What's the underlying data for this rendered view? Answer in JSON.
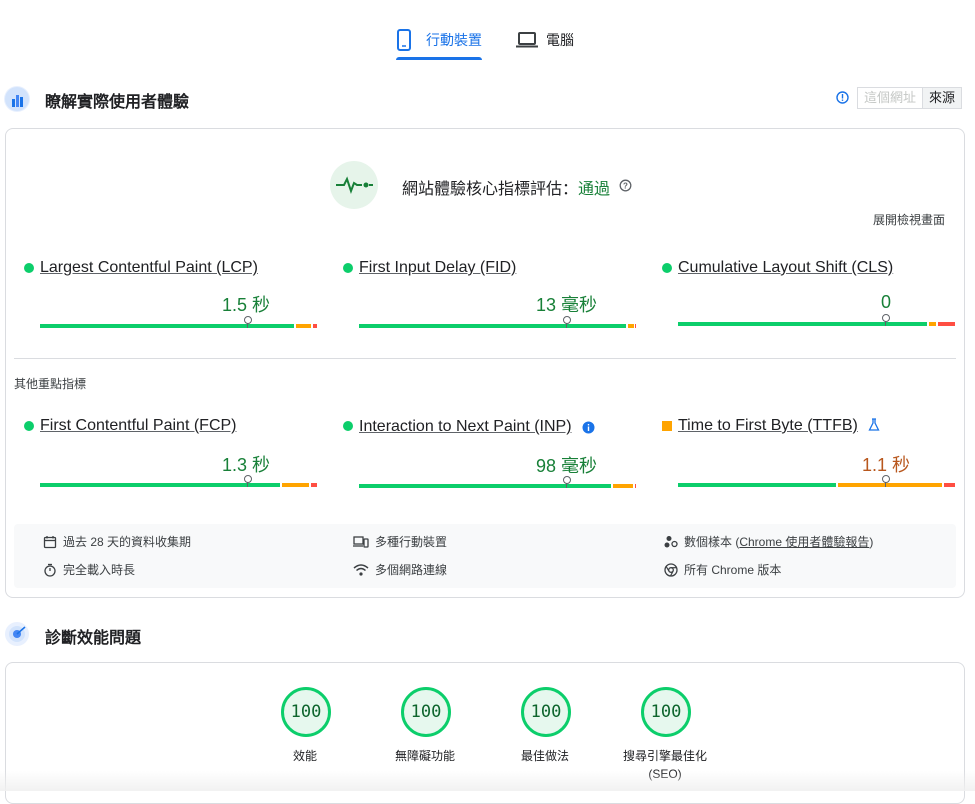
{
  "tabs": [
    {
      "label": "行動裝置",
      "icon": "smartphone-icon",
      "active": true
    },
    {
      "label": "電腦",
      "icon": "laptop-icon",
      "active": false
    }
  ],
  "field_section": {
    "title": "瞭解實際使用者體驗",
    "buttons": {
      "url": "這個網址",
      "origin": "來源"
    },
    "cwv": {
      "label": "網站體驗核心指標評估：",
      "status": "通過",
      "status_color": "#188038"
    },
    "expand_link": "展開檢視畫面",
    "metrics": [
      {
        "name": "Largest Contentful Paint (LCP)",
        "value": "1.5 秒",
        "rating": "good",
        "position": 0.75
      },
      {
        "name": "First Input Delay (FID)",
        "value": "13 毫秒",
        "rating": "good",
        "position": 0.75
      },
      {
        "name": "Cumulative Layout Shift (CLS)",
        "value": "0",
        "rating": "good",
        "position": 0.75
      }
    ],
    "other_label": "其他重點指標",
    "other_metrics": [
      {
        "name": "First Contentful Paint (FCP)",
        "value": "1.3 秒",
        "rating": "good",
        "position": 0.75
      },
      {
        "name": "Interaction to Next Paint (INP)",
        "value": "98 毫秒",
        "rating": "good",
        "position": 0.75
      },
      {
        "name": "Time to First Byte (TTFB)",
        "value": "1.1 秒",
        "rating": "needs-improvement",
        "position": 0.75
      }
    ],
    "info": {
      "period": "過去 28 天的資料收集期",
      "devices": "多種行動裝置",
      "samples_prefix": "數個樣本 (",
      "samples_link": "Chrome 使用者體驗報告",
      "samples_suffix": ")",
      "load": "完全載入時長",
      "network": "多個網路連線",
      "chrome": "所有 Chrome 版本"
    },
    "colors": {
      "good": "#0cce6b",
      "needs_improvement": "#ffa400",
      "poor": "#ff4e42"
    }
  },
  "diagnose_section": {
    "title": "診斷效能問題",
    "scores": [
      {
        "score": "100",
        "label": "效能",
        "label2": ""
      },
      {
        "score": "100",
        "label": "無障礙功能",
        "label2": ""
      },
      {
        "score": "100",
        "label": "最佳做法",
        "label2": ""
      },
      {
        "score": "100",
        "label": "搜尋引擎最佳化",
        "label2": "(SEO)"
      }
    ]
  }
}
